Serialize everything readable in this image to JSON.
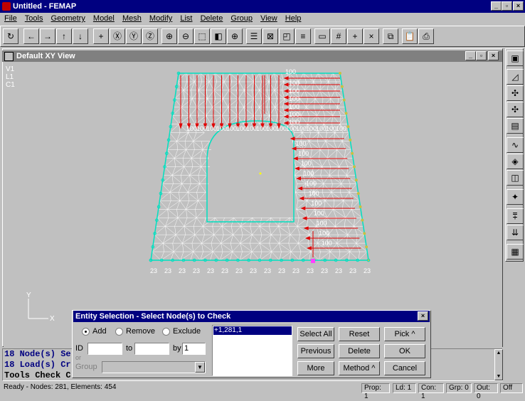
{
  "app": {
    "title": "Untitled - FEMAP"
  },
  "menu": [
    "File",
    "Tools",
    "Geometry",
    "Model",
    "Mesh",
    "Modify",
    "List",
    "Delete",
    "Group",
    "View",
    "Help"
  ],
  "view": {
    "title": "Default XY View",
    "labels": [
      "V1",
      "L1",
      "C1"
    ]
  },
  "load_labels": {
    "top": "100",
    "mid": "100",
    "bottom": "23"
  },
  "axis": {
    "x": "X",
    "y": "Y"
  },
  "messages": [
    "18 Node(s) Se",
    "18 Load(s) Cr",
    "Tools Check C"
  ],
  "status": {
    "main": "Ready - Nodes: 281,  Elements: 454",
    "prop": "Prop: 1",
    "ld": "Ld: 1",
    "con": "Con: 1",
    "grp": "Grp: 0",
    "out": "Out: 0",
    "off": "Off"
  },
  "dialog": {
    "title": "Entity Selection - Select Node(s) to Check",
    "mode_add": "Add",
    "mode_remove": "Remove",
    "mode_exclude": "Exclude",
    "id_label": "ID",
    "to_label": "to",
    "by_label": "by",
    "by_value": "1",
    "or_label": "or",
    "group_label": "Group",
    "list_item": "+1,281,1",
    "select_all": "Select All",
    "reset": "Reset",
    "pick": "Pick ^",
    "previous": "Previous",
    "delete": "Delete",
    "ok": "OK",
    "more": "More",
    "method": "Method ^",
    "cancel": "Cancel"
  },
  "colors": {
    "title_active": "#000080",
    "title_inactive": "#808080",
    "mesh": "#ffffff",
    "load": "#e00000",
    "boundary": "#00e0c0",
    "message": "#000080"
  }
}
